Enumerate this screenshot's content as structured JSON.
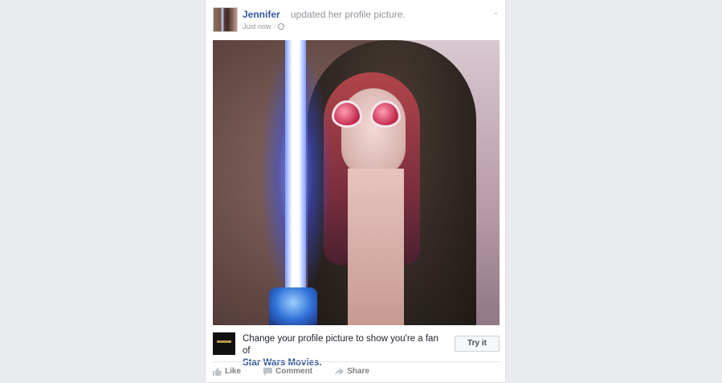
{
  "post": {
    "author": "Jennifer",
    "action_text": "updated her profile picture.",
    "timestamp": "Just now ·",
    "audience_icon": "globe-icon",
    "menu_icon": "chevron-down-icon"
  },
  "promo": {
    "text": "Change your profile picture to show you're a fan of",
    "link": "Star Wars Movies.",
    "button": "Try it"
  },
  "actions": {
    "like": "Like",
    "comment": "Comment",
    "share": "Share"
  },
  "colors": {
    "link": "#365899",
    "muted": "#90949c",
    "background": "#e9ebee"
  }
}
